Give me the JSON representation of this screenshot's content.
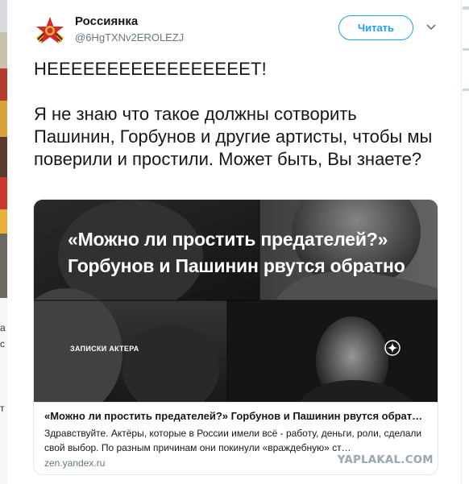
{
  "tweet": {
    "display_name": "Россиянка",
    "handle": "@6HgTXNv2EROLEZJ",
    "follow_label": "Читать",
    "text_lines": [
      "НЕЕЕЕЕЕЕЕЕЕЕЕЕЕЕЕЕТ!",
      "Я не знаю что такое должны сотворить Пашинин, Горбунов и другие артисты, чтобы мы поверили и простили. Может быть, Вы знаете?"
    ]
  },
  "card": {
    "image_headline": "«Можно ли простить предателей?» Горбунов и Пашинин рвутся обратно",
    "image_tag": "ЗАПИСКИ АКТЕРА",
    "title": "«Можно ли простить предателей?» Горбунов и Пашинин рвутся обрат…",
    "description": "Здравствуйте. Актёры, которые в России имели всё - работу, деньги, роли, сделали свой выбор. По разным причинам они покинули «враждебную» ст…",
    "domain": "zen.yandex.ru"
  },
  "watermark": "YAPLAKAL.COM",
  "left_strip_chars": [
    "а",
    "с",
    "т"
  ],
  "icons": {
    "avatar": "ribbon-star-avatar-icon",
    "caret": "chevron-down-icon",
    "badge": "zen-star-icon"
  },
  "colors": {
    "accent": "#1da1f2",
    "text": "#14171a",
    "muted": "#657786",
    "border": "#e1e8ed"
  }
}
